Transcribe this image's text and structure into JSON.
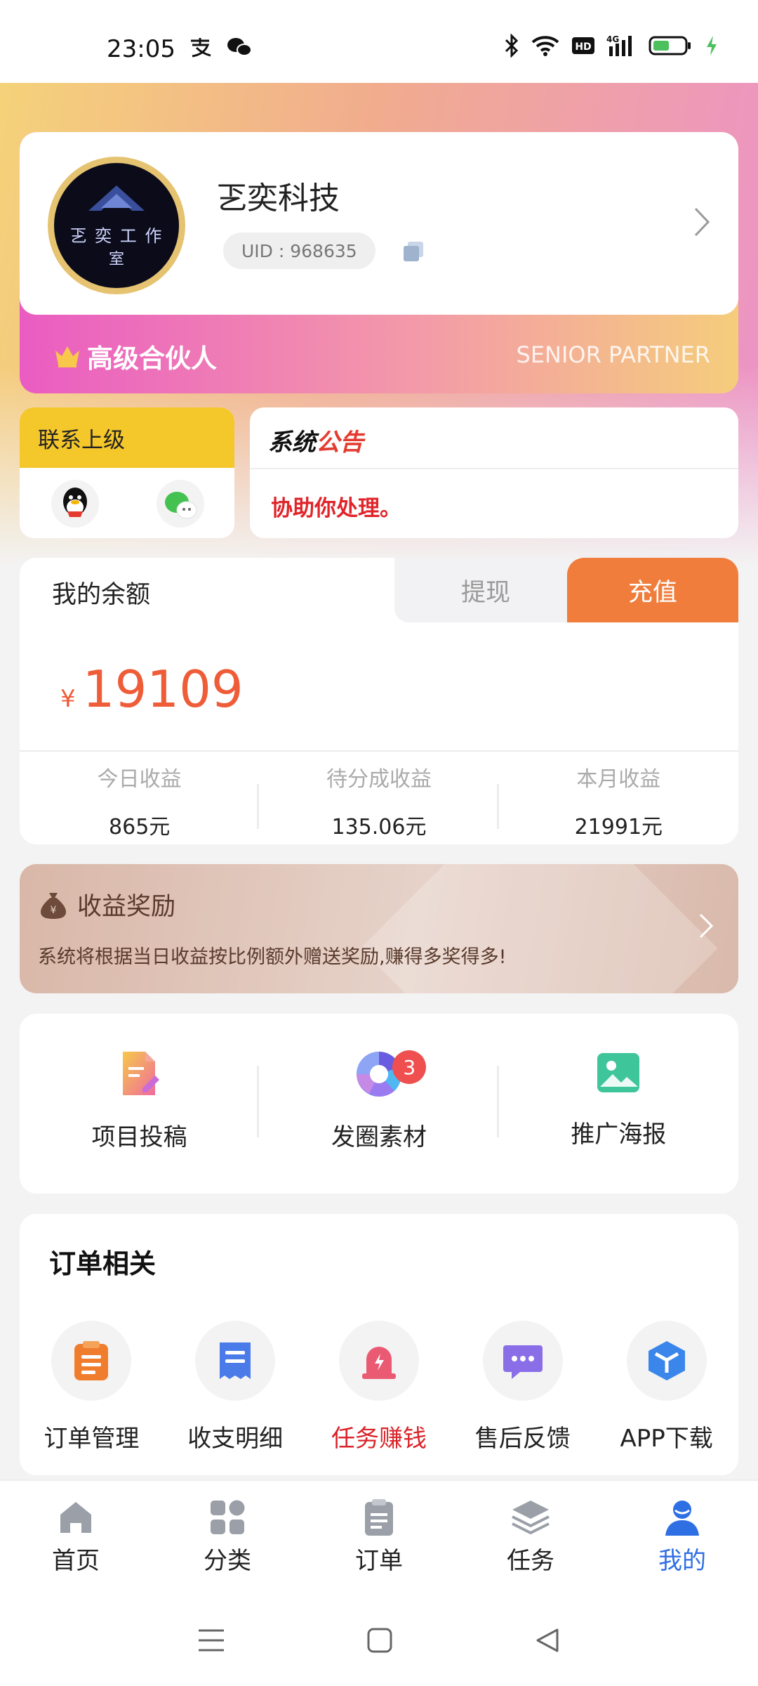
{
  "status": {
    "time": "23:05"
  },
  "profile": {
    "name": "乤奕科技",
    "uid": "UID : 968635",
    "avatar_text": "乤 奕 工 作",
    "avatar_text2": "室",
    "level": "高级合伙人",
    "level_en": "SENIOR PARTNER"
  },
  "contact": {
    "title": "联系上级"
  },
  "notice": {
    "title_part1": "系统",
    "title_part2": "公告",
    "text": "协助你处理。"
  },
  "balance": {
    "title": "我的余额",
    "withdraw_label": "提现",
    "recharge_label": "充值",
    "currency": "¥",
    "amount": "19109",
    "stats": [
      {
        "label": "今日收益",
        "value": "865元"
      },
      {
        "label": "待分成收益",
        "value": "135.06元"
      },
      {
        "label": "本月收益",
        "value": "21991元"
      }
    ]
  },
  "reward": {
    "title": "收益奖励",
    "desc": "系统将根据当日收益按比例额外赠送奖励,赚得多奖得多!"
  },
  "tools": [
    {
      "label": "项目投稿",
      "icon": "document-edit-icon"
    },
    {
      "label": "发圈素材",
      "icon": "aperture-icon",
      "badge": "3"
    },
    {
      "label": "推广海报",
      "icon": "image-icon"
    }
  ],
  "orders": {
    "title": "订单相关",
    "items": [
      {
        "label": "订单管理",
        "icon": "clipboard-icon",
        "color": "#f07d2e"
      },
      {
        "label": "收支明细",
        "icon": "receipt-icon",
        "color": "#4a7be8"
      },
      {
        "label": "任务赚钱",
        "icon": "alarm-icon",
        "color": "#ea5a73",
        "highlight": true
      },
      {
        "label": "售后反馈",
        "icon": "chat-icon",
        "color": "#8a6ee8"
      },
      {
        "label": "APP下载",
        "icon": "cube-icon",
        "color": "#3a86ea"
      }
    ]
  },
  "tabbar": [
    {
      "label": "首页",
      "icon": "home-icon"
    },
    {
      "label": "分类",
      "icon": "grid-icon"
    },
    {
      "label": "订单",
      "icon": "clipboard-icon"
    },
    {
      "label": "任务",
      "icon": "layers-icon"
    },
    {
      "label": "我的",
      "icon": "user-icon",
      "active": true
    }
  ],
  "colors": {
    "accent": "#f07d3c",
    "amount": "#ef5c38",
    "active_tab": "#2f6fe4"
  }
}
